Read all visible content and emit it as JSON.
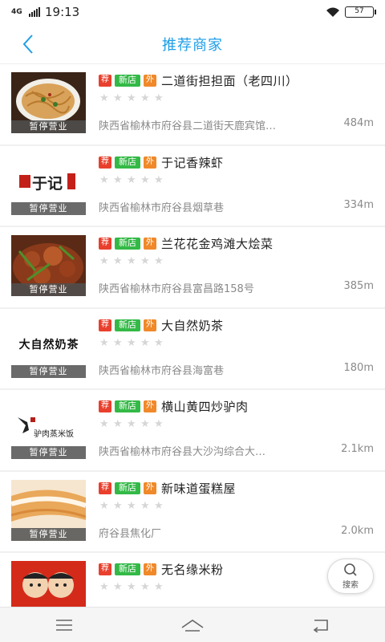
{
  "status_bar": {
    "network": "4G",
    "time": "19:13",
    "battery": "57"
  },
  "header": {
    "title": "推荐商家",
    "back_icon": "chevron-left-icon"
  },
  "badges": {
    "recommend": "荐",
    "new_shop": "新店",
    "takeout": "外"
  },
  "paused_label": "暂停营业",
  "shops": [
    {
      "name": "二道街担担面（老四川）",
      "address": "陕西省榆林市府谷县二道街天鹿宾馆…",
      "distance": "484m",
      "rating": 0,
      "thumb_text": "",
      "show_takeout": true
    },
    {
      "name": "于记香辣虾",
      "address": "陕西省榆林市府谷县烟草巷",
      "distance": "334m",
      "rating": 0,
      "thumb_text": "于记",
      "show_takeout": true
    },
    {
      "name": "兰花花金鸡滩大烩菜",
      "address": "陕西省榆林市府谷县富昌路158号",
      "distance": "385m",
      "rating": 0,
      "thumb_text": "",
      "show_takeout": true
    },
    {
      "name": "大自然奶茶",
      "address": "陕西省榆林市府谷县海富巷",
      "distance": "180m",
      "rating": 0,
      "thumb_text": "大自然奶茶",
      "show_takeout": true
    },
    {
      "name": "横山黄四炒驴肉",
      "address": "陕西省榆林市府谷县大沙沟综合大…",
      "distance": "2.1km",
      "rating": 0,
      "thumb_text": "驴肉蒸米饭",
      "show_takeout": true
    },
    {
      "name": "新味道蛋糕屋",
      "address": "府谷县焦化厂",
      "distance": "2.0km",
      "rating": 0,
      "thumb_text": "",
      "show_takeout": true
    },
    {
      "name": "无名缘米粉",
      "address": "",
      "distance": "",
      "rating": 0,
      "thumb_text": "",
      "show_takeout": true
    }
  ],
  "search_fab": {
    "label": "搜索",
    "icon": "search-icon"
  },
  "nav": {
    "menu_icon": "menu-icon",
    "home_icon": "home-icon",
    "back_icon": "back-arrow-icon"
  },
  "colors": {
    "accent": "#1e9ee8",
    "recommend": "#e8402d",
    "new_shop": "#33b946",
    "takeout": "#f0892a"
  }
}
